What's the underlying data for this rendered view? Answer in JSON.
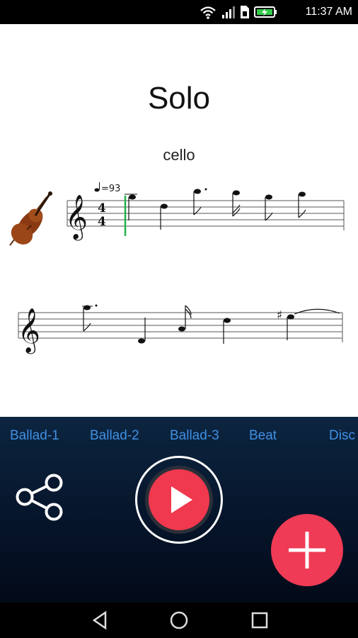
{
  "status_bar": {
    "time": "11:37 AM",
    "icons": [
      "wifi-icon",
      "signal-icon",
      "sim-icon",
      "battery-charging-icon"
    ]
  },
  "score": {
    "title": "Solo",
    "instrument": "cello",
    "instrument_icon": "cello-icon",
    "tempo_label": "=93",
    "time_signature": {
      "top": "4",
      "bottom": "4"
    }
  },
  "style_tabs": [
    "Ballad-1",
    "Ballad-2",
    "Ballad-3",
    "Beat",
    "Disc"
  ],
  "actions": {
    "share_icon": "share-icon",
    "play_icon": "play-icon",
    "add_icon": "plus-icon"
  },
  "colors": {
    "accent": "#f0384e",
    "tab_text": "#3f90e6",
    "playhead": "#22b14c",
    "controls_bg": "#06152b"
  },
  "nav_bar": [
    "back-icon",
    "home-icon",
    "recents-icon"
  ]
}
